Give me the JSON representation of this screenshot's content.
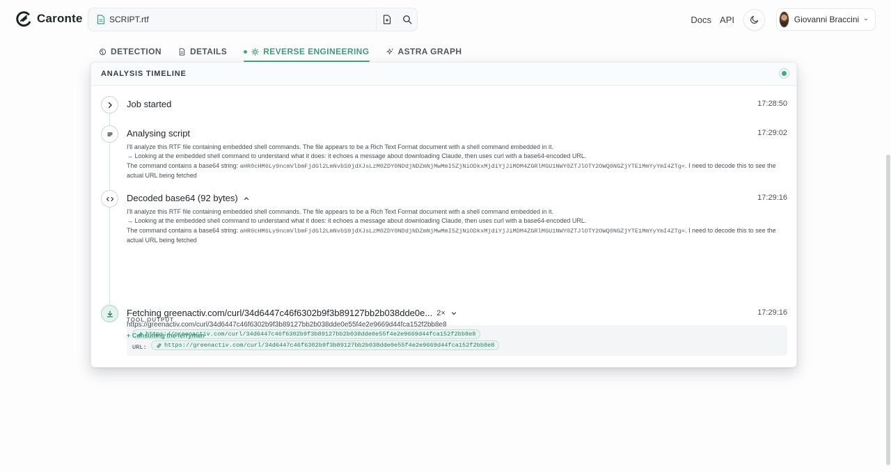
{
  "header": {
    "app_name": "Caronte",
    "file_name": "SCRIPT.rtf",
    "nav_docs": "Docs",
    "nav_api": "API",
    "user_name": "Giovanni Braccini"
  },
  "tabs": [
    {
      "label": "DETECTION",
      "icon": "fingerprint-icon",
      "active": false
    },
    {
      "label": "DETAILS",
      "icon": "document-icon",
      "active": false
    },
    {
      "label": "REVERSE ENGINEERING",
      "icon": "gear-icon",
      "active": true
    },
    {
      "label": "ASTRA GRAPH",
      "icon": "sparkle-icon",
      "active": false
    }
  ],
  "timeline": {
    "title": "ANALYSIS TIMELINE",
    "events": [
      {
        "title": "Job started",
        "time": "17:28:50",
        "icon": "chevron-right-icon"
      },
      {
        "title": "Analysing script",
        "time": "17:29:02",
        "icon": "lines-icon",
        "line1": "I'll analyze this RTF file containing embedded shell commands. The file appears to be a Rich Text Format document with a shell command embedded in it.",
        "line2": "→ Looking at the embedded shell command to understand what it does: it echoes a message about downloading Claude, then uses curl with a base64-encoded URL.",
        "line3_prefix": "The command contains a base64 string: ",
        "line3_code": "aHR0cHM6Ly9ncmVlbmFjdGl2LmNvbS9jdXJsLzM0ZDY0NDdjNDZmNjMwMmI5ZjNiODkxMjdiYjJiMDM4ZGRlMGU1NWY0ZTJlOTY2OWQ0NGZjYTE1MmYyYmI4ZTg=",
        "line3_suffix": ". I need to decode this to see the",
        "line4": "actual URL being fetched"
      },
      {
        "title": "Decoded base64 (92 bytes)",
        "time": "17:29:16",
        "icon": "code-icon",
        "line1": "I'll analyze this RTF file containing embedded shell commands. The file appears to be a Rich Text Format document with a shell command embedded in it.",
        "line2": "→ Looking at the embedded shell command to understand what it does: it echoes a message about downloading Claude, then uses curl with a base64-encoded URL.",
        "line3_prefix": "The command contains a base64 string: ",
        "line3_code": "aHR0cHM6Ly9ncmVlbmFjdGl2LmNvbS9jdXJsLzM0ZDY0NDdjNDZmNjMwMmI5ZjNiODkxMjdiYjJiMDM4ZGRlMGU1NWY0ZTJlOTY2OWQ0NGZjYTE1MmYyYmI4ZTg=",
        "line3_suffix": ". I need to decode this to see the",
        "line4": "actual URL being fetched",
        "tool_output_label": "TOOL OUTPUT",
        "url_pill": "https://greenactiv.com/curl/34d6447c46f6302b9f3b89127bb2b038dde0e55f4e2e9669d44fca152f2bb8e8",
        "url_label": "URL:"
      },
      {
        "title": "Fetching greenactiv.com/curl/34d6447c46f6302b9f3b89127bb2b038dde0e...",
        "count": "2×",
        "time": "17:29:16",
        "icon": "download-icon",
        "subtitle": "https://greenactiv.com/curl/34d6447c46f6302b9f3b89127bb2b038dde0e55f4e2e9669d44fca152f2bb8e8",
        "status": "+ Consulting the ferryman"
      }
    ]
  },
  "colors": {
    "accent": "#4aa487",
    "accent_text": "#3e9b7e"
  }
}
